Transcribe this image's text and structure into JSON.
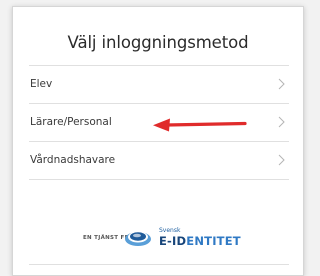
{
  "title": "Välj inloggningsmetod",
  "options": [
    {
      "label": "Elev",
      "icon": "chevron-right-icon"
    },
    {
      "label": "Lärare/Personal",
      "icon": "chevron-right-icon"
    },
    {
      "label": "Vårdnadshavare",
      "icon": "chevron-right-icon"
    }
  ],
  "annotation": {
    "icon": "red-arrow-icon",
    "color": "#e02b2b",
    "points_to": "Lärare/Personal"
  },
  "footer": {
    "prefix": "EN TJÄNST FRÅN",
    "logo_icon": "e-identitet-logo",
    "svensk": "Svensk",
    "brand_a": "E-ID",
    "brand_b": "ENTITET",
    "brand_color": "#17457a",
    "accent_color": "#2f79c4"
  }
}
